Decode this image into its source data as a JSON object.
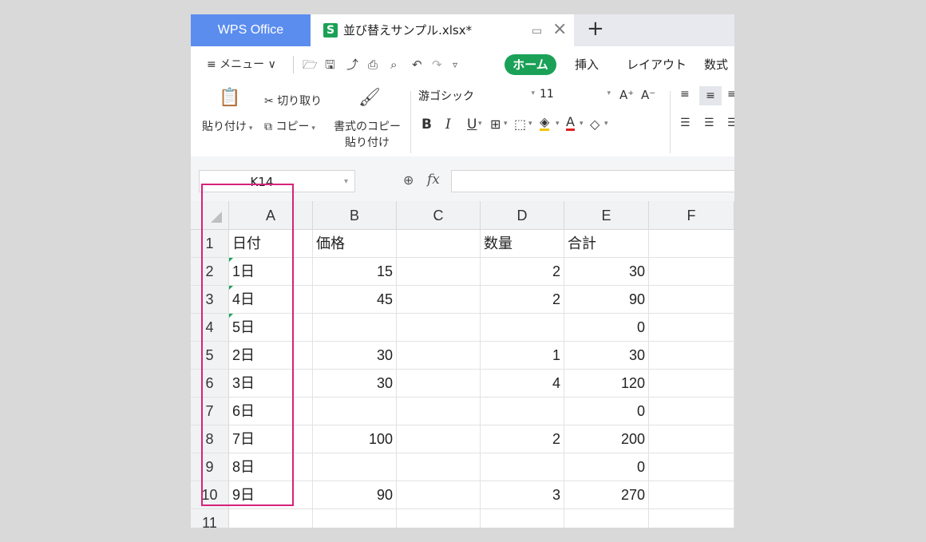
{
  "tabs": {
    "app": "WPS Office",
    "file": "並び替えサンプル.xlsx*",
    "file_icon": "S"
  },
  "menu": {
    "menu_label": "≡ メニュー ∨",
    "home": "ホーム",
    "insert": "挿入",
    "layout": "レイアウト",
    "formula": "数式"
  },
  "ribbon": {
    "paste": "貼り付け",
    "cut": "切り取り",
    "copy": "コピー",
    "format_painter_line1": "書式のコピー",
    "format_painter_line2": "貼り付け",
    "font_name": "游ゴシック",
    "font_size": "11"
  },
  "formula_bar": {
    "cell_ref": "K14",
    "fx": "fx",
    "content": ""
  },
  "grid": {
    "columns": [
      "A",
      "B",
      "C",
      "D",
      "E",
      "F"
    ],
    "rows": [
      "1",
      "2",
      "3",
      "4",
      "5",
      "6",
      "7",
      "8",
      "9",
      "10",
      "11"
    ],
    "cells": [
      [
        "日付",
        "価格",
        "",
        "数量",
        "合計",
        ""
      ],
      [
        " 1日",
        "15",
        "",
        "2",
        "30",
        ""
      ],
      [
        " 4日",
        "45",
        "",
        "2",
        "90",
        ""
      ],
      [
        " 5日",
        "",
        "",
        "",
        "0",
        ""
      ],
      [
        "2日",
        "30",
        "",
        "1",
        "30",
        ""
      ],
      [
        "3日",
        "30",
        "",
        "4",
        "120",
        ""
      ],
      [
        "6日",
        "",
        "",
        "",
        "0",
        ""
      ],
      [
        "7日",
        "100",
        "",
        "2",
        "200",
        ""
      ],
      [
        "8日",
        "",
        "",
        "",
        "0",
        ""
      ],
      [
        "9日",
        "90",
        "",
        "3",
        "270",
        ""
      ],
      [
        "",
        "",
        "",
        "",
        "",
        ""
      ]
    ],
    "text_marker_rows": [
      1,
      2,
      3
    ]
  },
  "colors": {
    "brand_blue": "#5b8def",
    "wps_green": "#1aa157",
    "highlight": "#d6227a"
  }
}
